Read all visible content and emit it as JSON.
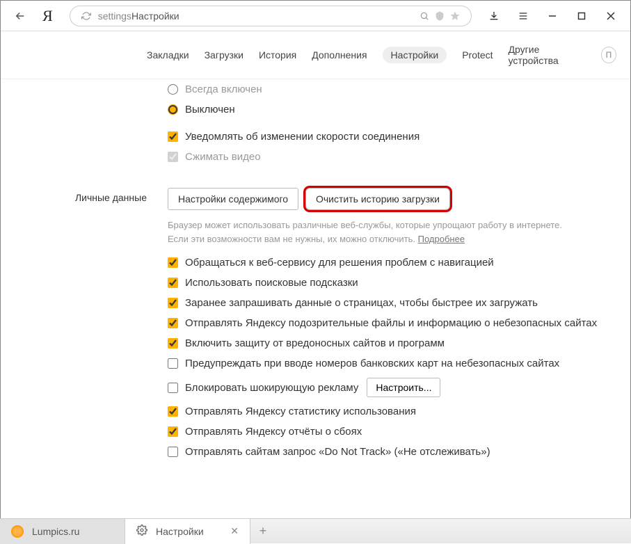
{
  "address": {
    "url_part1": "settings",
    "url_part2": " Настройки"
  },
  "nav": {
    "items": [
      "Закладки",
      "Загрузки",
      "История",
      "Дополнения",
      "Настройки",
      "Protect",
      "Другие устройства"
    ],
    "active": 4,
    "user": "П"
  },
  "turbo": {
    "opt_always": "Всегда включен",
    "opt_off": "Выключен",
    "notify": "Уведомлять об изменении скорости соединения",
    "compress": "Сжимать видео"
  },
  "section": {
    "label": "Личные данные",
    "btn_content": "Настройки содержимого",
    "btn_clear": "Очистить историю загрузки",
    "hint1": "Браузер может использовать различные веб-службы, которые упрощают работу в интернете. Если эти возможности вам не нужны, их можно отключить. ",
    "hint_link": "Подробнее"
  },
  "opts": {
    "o1": "Обращаться к веб-сервису для решения проблем с навигацией",
    "o2": "Использовать поисковые подсказки",
    "o3": "Заранее запрашивать данные о страницах, чтобы быстрее их загружать",
    "o4": "Отправлять Яндексу подозрительные файлы и информацию о небезопасных сайтах",
    "o5": "Включить защиту от вредоносных сайтов и программ",
    "o6": "Предупреждать при вводе номеров банковских карт на небезопасных сайтах",
    "o7": "Блокировать шокирующую рекламу",
    "o7_btn": "Настроить...",
    "o8": "Отправлять Яндексу статистику использования",
    "o9": "Отправлять Яндексу отчёты о сбоях",
    "o10": "Отправлять сайтам запрос «Do Not Track» («Не отслеживать»)"
  },
  "tabs": {
    "t1": "Lumpics.ru",
    "t2": "Настройки"
  }
}
